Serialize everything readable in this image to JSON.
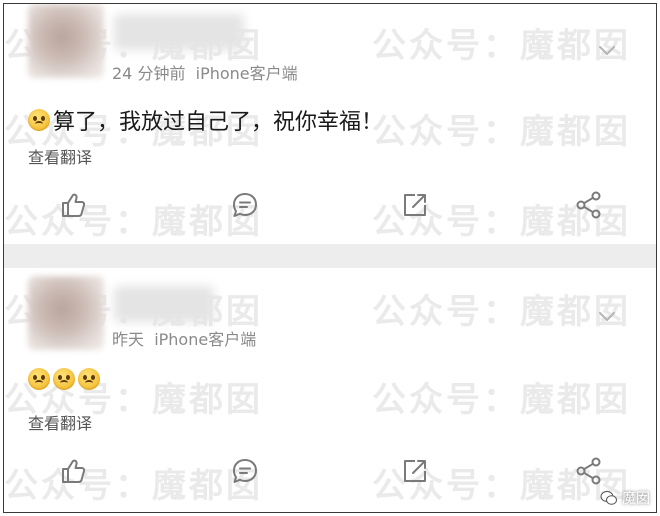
{
  "posts": [
    {
      "time": "24 分钟前",
      "client": "iPhone客户端",
      "text": "算了，我放过自己了，祝你幸福！",
      "emoji_count": 1,
      "translate_label": "查看翻译"
    },
    {
      "time": "昨天",
      "client": "iPhone客户端",
      "text": "",
      "emoji_count": 3,
      "translate_label": "查看翻译"
    }
  ],
  "watermark": {
    "left": "公众号：魔都囡",
    "right": "公众号：魔都囡"
  },
  "badge": {
    "label": "魔囡",
    "icon": "wechat-icon"
  },
  "icons": {
    "like": "thumbs-up-icon",
    "comment": "comment-icon",
    "share": "share-out-icon",
    "forward": "share-nodes-icon",
    "menu": "chevron-down-icon"
  },
  "colors": {
    "meta_text": "#8a8a8a",
    "divider": "#ededed",
    "icon_stroke": "#7a7a7a"
  }
}
